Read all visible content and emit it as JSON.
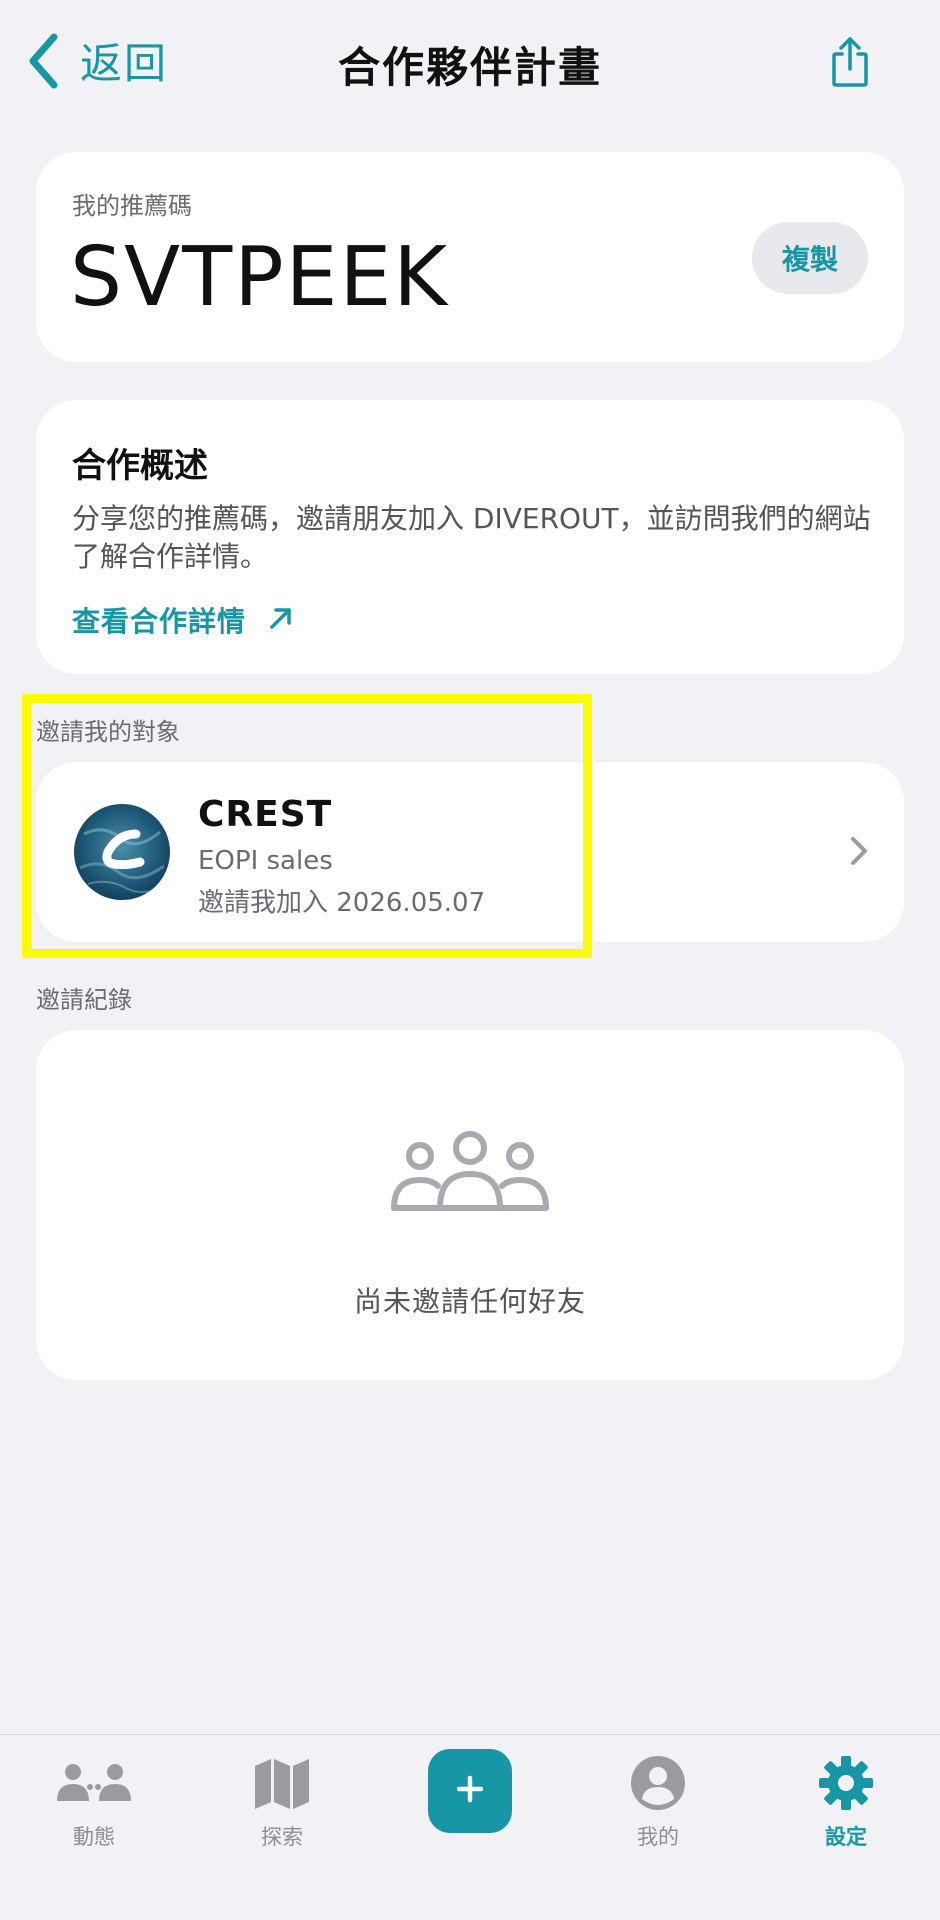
{
  "header": {
    "back_label": "返回",
    "title": "合作夥伴計畫",
    "share_icon": "share-icon"
  },
  "referral": {
    "label": "我的推薦碼",
    "code": "SVTPEEK",
    "copy_label": "複製"
  },
  "overview": {
    "title": "合作概述",
    "description": "分享您的推薦碼，邀請朋友加入 DIVEROUT，並訪問我們的網站了解合作詳情。",
    "link_label": "查看合作詳情"
  },
  "inviter": {
    "section_label": "邀請我的對象",
    "name": "CREST",
    "role": "EOPI sales",
    "joined": "邀請我加入 2026.05.07"
  },
  "records": {
    "section_label": "邀請紀錄",
    "empty_text": "尚未邀請任何好友"
  },
  "tabbar": {
    "feed": "動態",
    "explore": "探索",
    "add_icon": "plus-icon",
    "profile": "我的",
    "settings": "設定",
    "active": "settings"
  },
  "colors": {
    "accent": "#1796a6",
    "background": "#f2f2f6",
    "highlight": "#fdfb00"
  }
}
